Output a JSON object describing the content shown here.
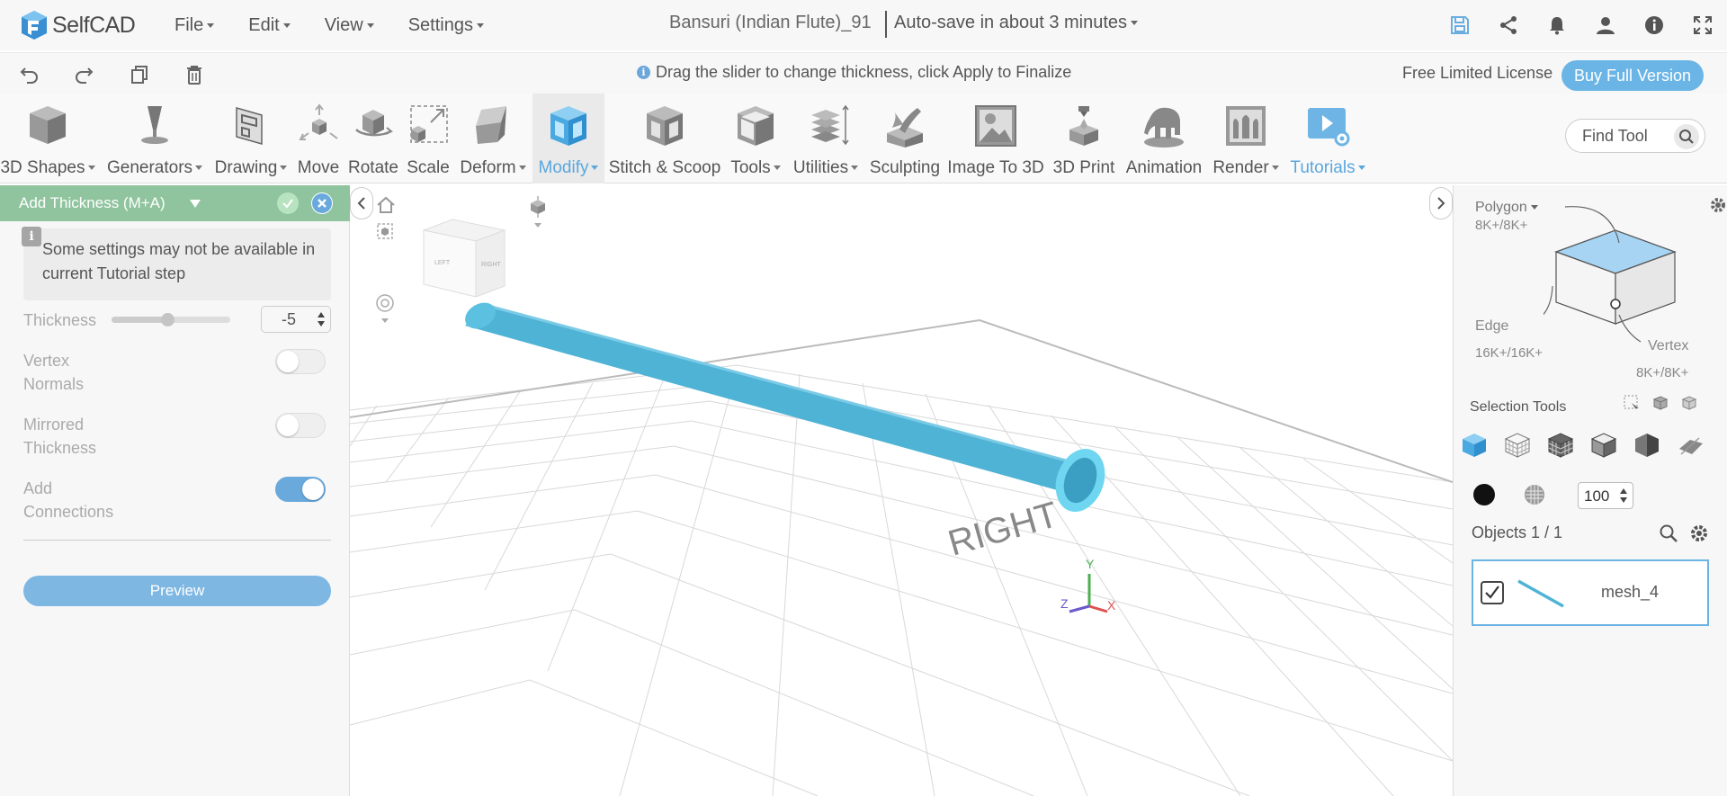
{
  "app": {
    "logo_text": "SelfCAD",
    "menu": [
      "File",
      "Edit",
      "View",
      "Settings"
    ],
    "document_title": "Bansuri (Indian Flute)_91",
    "autosave": "Auto-save in about 3 minutes",
    "top_icons": [
      "save-icon",
      "share-icon",
      "bell-icon",
      "user-icon",
      "info-icon",
      "fullscreen-icon"
    ]
  },
  "hintbar": {
    "history_icons": [
      "undo-icon",
      "redo-icon",
      "copy-icon",
      "delete-icon"
    ],
    "hint": "Drag the slider to change thickness, click Apply to Finalize",
    "license": "Free Limited License",
    "buy_label": "Buy Full Version"
  },
  "toolbar": {
    "tools": [
      {
        "label": "3D Shapes",
        "icon": "cube-icon"
      },
      {
        "label": "Generators",
        "icon": "generators-icon"
      },
      {
        "label": "Drawing",
        "icon": "drawing-icon"
      },
      {
        "label": "Move",
        "icon": "move-icon"
      },
      {
        "label": "Rotate",
        "icon": "rotate-icon"
      },
      {
        "label": "Scale",
        "icon": "scale-icon"
      },
      {
        "label": "Deform",
        "icon": "deform-icon"
      },
      {
        "label": "Modify",
        "icon": "modify-icon"
      },
      {
        "label": "Stitch & Scoop",
        "icon": "stitch-scoop-icon"
      },
      {
        "label": "Tools",
        "icon": "tools-icon"
      },
      {
        "label": "Utilities",
        "icon": "utilities-icon"
      },
      {
        "label": "Sculpting",
        "icon": "sculpting-icon"
      },
      {
        "label": "Image To 3D",
        "icon": "image-to-3d-icon"
      },
      {
        "label": "3D Print",
        "icon": "3d-print-icon"
      },
      {
        "label": "Animation",
        "icon": "animation-icon"
      },
      {
        "label": "Render",
        "icon": "render-icon"
      },
      {
        "label": "Tutorials",
        "icon": "tutorials-icon"
      }
    ],
    "active_tool": "Modify",
    "find_placeholder": "Find Tool"
  },
  "panel": {
    "title": "Add Thickness (M+A)",
    "notice": "Some settings may not be available in current Tutorial step",
    "thickness_label": "Thickness",
    "thickness_value": "-5",
    "thickness_slider_fraction": 0.47,
    "vertex_normals_label": "Vertex Normals",
    "vertex_normals_on": false,
    "mirrored_label": "Mirrored Thickness",
    "mirrored_on": false,
    "connections_label": "Add Connections",
    "connections_on": true,
    "preview_label": "Preview"
  },
  "viewport": {
    "view_cube_labels": [
      "LEFT",
      "RIGHT"
    ],
    "ground_label": "RIGHT",
    "axes": {
      "x": "X",
      "y": "Y",
      "z": "Z"
    },
    "object_color": "#4fb3d5"
  },
  "rightpanel": {
    "polygon_label": "Polygon",
    "polygon_count": "8K+/8K+",
    "edge_label": "Edge",
    "edge_count": "16K+/16K+",
    "vertex_label": "Vertex",
    "vertex_count": "8K+/8K+",
    "selection_tools": "Selection Tools",
    "opacity": "100",
    "objects_title": "Objects 1 / 1",
    "object_name": "mesh_4",
    "accent": "#6ab3e2"
  }
}
